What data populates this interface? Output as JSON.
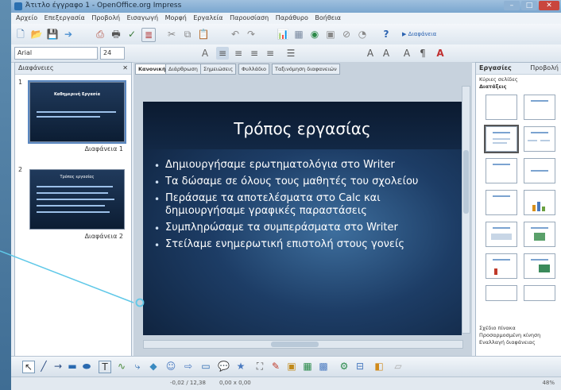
{
  "window": {
    "title": "Άτιτλο έγγραφο 1 - OpenOffice.org Impress"
  },
  "menu": [
    "Αρχείο",
    "Επεξεργασία",
    "Προβολή",
    "Εισαγωγή",
    "Μορφή",
    "Εργαλεία",
    "Παρουσίαση",
    "Παράθυρο",
    "Βοήθεια"
  ],
  "font": {
    "name": "Arial",
    "size": "24"
  },
  "slides_pane": {
    "title": "Διαφάνειες",
    "slides": [
      {
        "num": "1",
        "label": "Διαφάνεια 1",
        "thumb_title": "Καθημερινή Εργασία"
      },
      {
        "num": "2",
        "label": "Διαφάνεια 2",
        "thumb_title": "Τρόπος εργασίας"
      }
    ]
  },
  "tabs": [
    "Κανονική",
    "Διάρθρωση",
    "Σημειώσεις",
    "Φυλλάδιο",
    "Ταξινόμηση διαφανειών"
  ],
  "slide": {
    "title": "Τρόπος εργασίας",
    "bullets": [
      "Δημιουργήσαμε ερωτηματολόγια στο Writer",
      "Τα δώσαμε σε όλους τους μαθητές του σχολείου",
      "Περάσαμε τα αποτελέσματα στο Calc και δημιουργήσαμε γραφικές παραστάσεις",
      "Συμπληρώσαμε τα συμπεράσματα στο Writer",
      "Στείλαμε ενημερωτική επιστολή στους γονείς"
    ]
  },
  "task_pane": {
    "title": "Εργασίες",
    "view_label": "Προβολή",
    "sections": [
      "Κύριες σελίδες",
      "Διατάξεις"
    ],
    "bottom_sections": [
      "Σχέδιο πίνακα",
      "Προσαρμοσμένη κίνηση",
      "Εναλλαγή διαφάνειας"
    ]
  },
  "status": {
    "position": "-0,02 / 12,38",
    "size": "0,00 x 0,00",
    "zoom": "48%"
  },
  "colors": {
    "slide_bg": "#1d3d66",
    "accent": "#5fc8e8"
  }
}
